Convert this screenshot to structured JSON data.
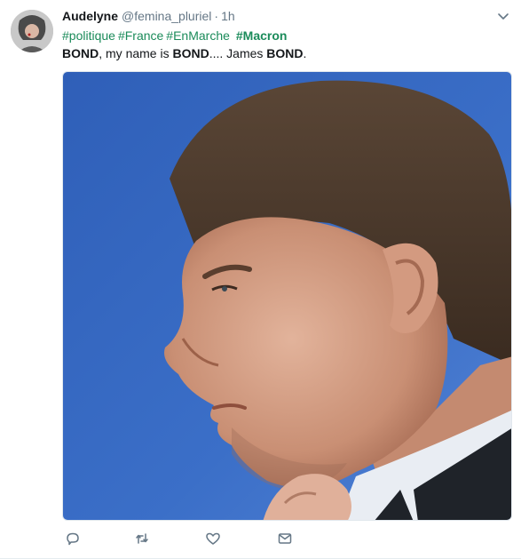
{
  "tweet": {
    "author_name": "Audelyne",
    "author_handle": "@femina_pluriel",
    "separator": "·",
    "time": "1h",
    "hashtags": [
      "#politique",
      "#France",
      "#EnMarche",
      "#Macron"
    ],
    "text_parts": [
      "BOND",
      ", my name is ",
      "BOND",
      ".... James ",
      "BOND",
      "."
    ]
  },
  "colors": {
    "hashtag": "#1b8b5a",
    "meta": "#657786",
    "icon": "#657786"
  },
  "icons": [
    "reply-icon",
    "retweet-icon",
    "like-icon",
    "direct-message-icon",
    "chevron-down-icon"
  ]
}
